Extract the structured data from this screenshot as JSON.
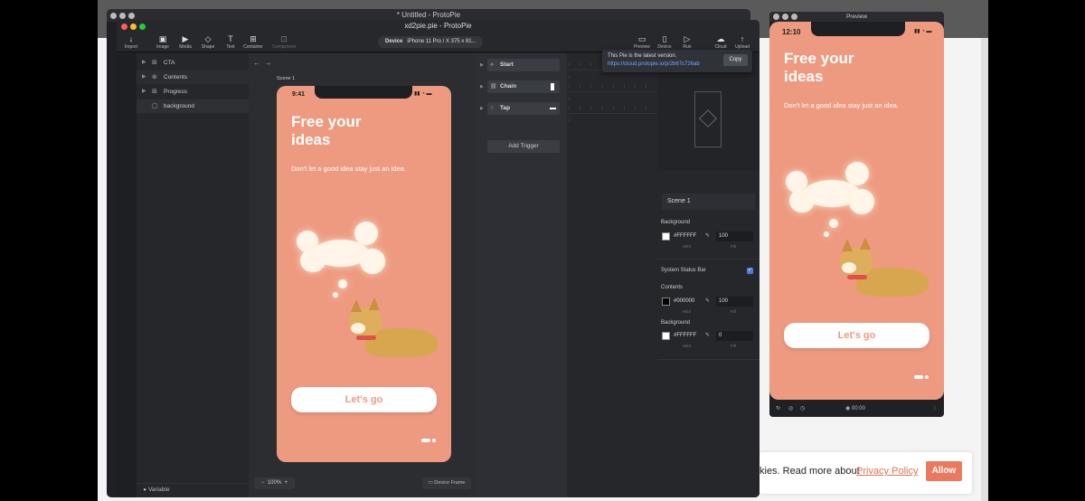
{
  "back_window": {
    "title": "* Untitled - ProtoPie"
  },
  "window": {
    "title": "xd2pie.pie - ProtoPie"
  },
  "toolbar": {
    "left_tools": [
      {
        "label": "Import",
        "icon": "↓"
      },
      {
        "label": "Image",
        "icon": "▣"
      },
      {
        "label": "Media",
        "icon": "▶"
      },
      {
        "label": "Shape",
        "icon": "◇"
      },
      {
        "label": "Text",
        "icon": "T"
      },
      {
        "label": "Container",
        "icon": "⊞"
      },
      {
        "label": "Component",
        "icon": "⊡"
      }
    ],
    "device_label": "Device",
    "device_value": "iPhone 11 Pro / X  375 x 81...",
    "right_tools": [
      {
        "label": "Preview",
        "icon": "▭"
      },
      {
        "label": "Device",
        "icon": "▯"
      },
      {
        "label": "Run",
        "icon": "▷"
      },
      {
        "label": "Cloud",
        "icon": "☁"
      },
      {
        "label": "Upload",
        "icon": "↑"
      }
    ]
  },
  "layers": {
    "items": [
      {
        "label": "CTA"
      },
      {
        "label": "Contents"
      },
      {
        "label": "Progress"
      },
      {
        "label": "background"
      }
    ],
    "variable_label": "Variable"
  },
  "canvas": {
    "scene_label": "Scene 1",
    "zoom": "100%",
    "frame_button": "Device Frame"
  },
  "phone": {
    "time_main": "9:41",
    "time_preview": "12:10",
    "headline": "Free your ideas",
    "subtitle": "Don't let a good idea stay just an idea.",
    "cta": "Let's go",
    "background_color": "#ee9a80"
  },
  "triggers": {
    "items": [
      {
        "label": "Start",
        "icon": "⟡"
      },
      {
        "label": "Chain",
        "icon": "⛓"
      },
      {
        "label": "Tap",
        "icon": "☝"
      }
    ],
    "add_label": "Add Trigger"
  },
  "tooltip": {
    "message": "This Pie is the latest version.",
    "url": "https://cloud.protopie.io/p/2b67c726ab",
    "copy_label": "Copy"
  },
  "properties": {
    "scene_name": "Scene 1",
    "background_label": "Background",
    "background_hex": "#FFFFFF",
    "background_fill": "100",
    "status_bar_label": "System Status Bar",
    "contents_label": "Contents",
    "contents_hex": "#000000",
    "contents_fill": "100",
    "status_bg_label": "Background",
    "status_bg_hex": "#FFFFFF",
    "status_bg_fill": "0",
    "hex_caption": "HEX",
    "fill_caption": "Fill"
  },
  "preview": {
    "title": "Preview",
    "timer": "00:00"
  },
  "cookie": {
    "text": "kies. Read more about",
    "link": "Privacy Policy",
    "button": "Allow"
  }
}
